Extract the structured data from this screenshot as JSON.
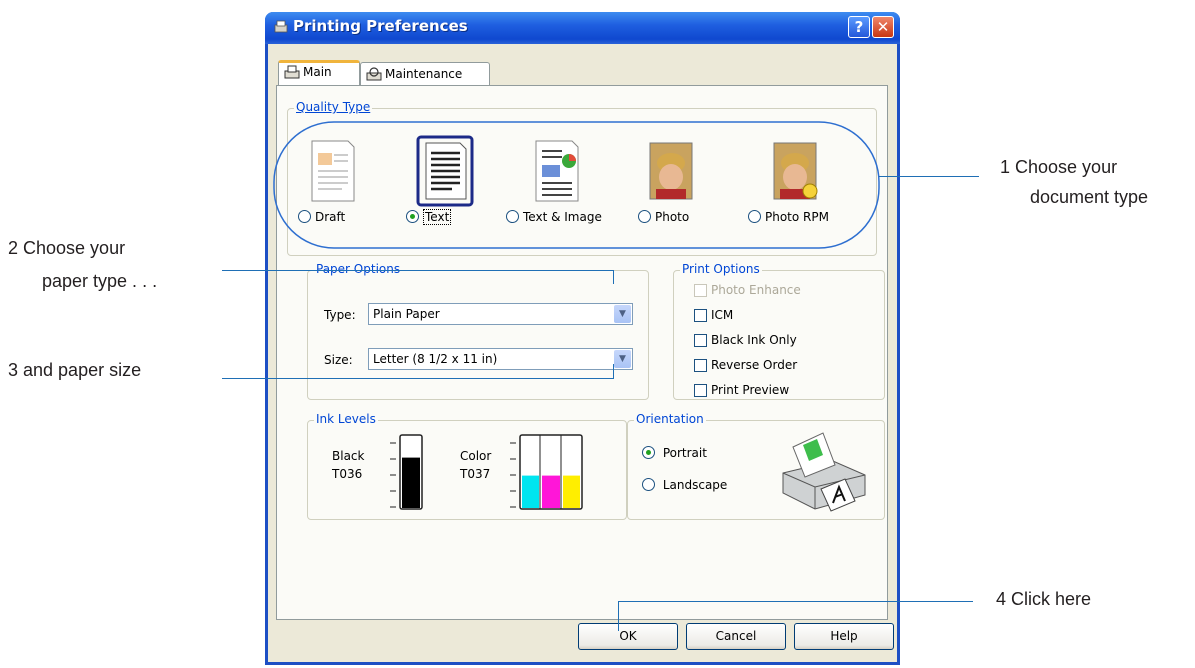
{
  "window": {
    "title": "Printing Preferences",
    "help_label": "?",
    "close_label": "✕"
  },
  "tabs": [
    {
      "label": "Main"
    },
    {
      "label": "Maintenance"
    }
  ],
  "quality_type": {
    "title": "Quality Type",
    "options": [
      {
        "label": "Draft",
        "selected": false
      },
      {
        "label": "Text",
        "selected": true
      },
      {
        "label": "Text & Image",
        "selected": false
      },
      {
        "label": "Photo",
        "selected": false
      },
      {
        "label": "Photo RPM",
        "selected": false
      }
    ]
  },
  "paper_options": {
    "title": "Paper Options",
    "type_label": "Type:",
    "type_value": "Plain Paper",
    "size_label": "Size:",
    "size_value": "Letter (8 1/2 x 11 in)"
  },
  "print_options": {
    "title": "Print Options",
    "items": [
      {
        "label": "Photo Enhance",
        "enabled": false
      },
      {
        "label": "ICM",
        "enabled": true
      },
      {
        "label": "Black Ink Only",
        "enabled": true
      },
      {
        "label": "Reverse Order",
        "enabled": true
      },
      {
        "label": "Print Preview",
        "enabled": true
      }
    ]
  },
  "ink_levels": {
    "title": "Ink Levels",
    "black_name": "Black",
    "black_code": "T036",
    "color_name": "Color",
    "color_code": "T037",
    "black_level": 0.7,
    "cyan_level": 0.45,
    "magenta_level": 0.45,
    "yellow_level": 0.45
  },
  "orientation": {
    "title": "Orientation",
    "portrait_label": "Portrait",
    "landscape_label": "Landscape",
    "selected": "Portrait"
  },
  "buttons": {
    "ok": "OK",
    "cancel": "Cancel",
    "help": "Help"
  },
  "annotations": {
    "a1_line1": "1 Choose your",
    "a1_line2": "document type",
    "a2_line1": "2 Choose your",
    "a2_line2": "paper type . . .",
    "a3": "3 and paper size",
    "a4": "4 Click here"
  },
  "colors": {
    "title_bar": "#1f5fe0",
    "group_title": "#0046d5",
    "callout_line": "#1f6fb5",
    "radio_dot": "#21a121"
  }
}
